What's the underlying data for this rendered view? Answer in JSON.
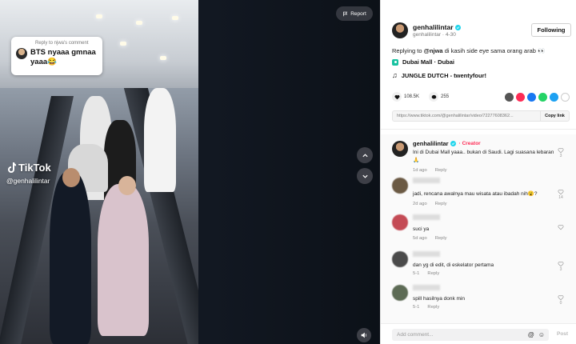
{
  "video": {
    "reply_to": "Reply to njwa's comment",
    "reply_text": "BTS nyaaa gmnaa yaaa😂",
    "watermark": "TikTok",
    "handle": "@genhalilintar",
    "report_label": "Report"
  },
  "post": {
    "username": "genhalilintar",
    "sub": "genhalilintar · 4-30",
    "follow_label": "Following",
    "description_prefix": "Replying to",
    "mention": "@njwa",
    "description_rest": " di kasih side eye sama orang arab 👀",
    "location": "Dubai Mall · Dubai",
    "music": "JUNGLE DUTCH - twentyfour!",
    "likes": "108.5K",
    "comments": "255",
    "link": "https://www.tiktok.com/@genhalilintar/video/72277608362...",
    "copy_label": "Copy link",
    "share_colors": [
      "#555555",
      "#fe2c55",
      "#1877f2",
      "#25d366",
      "#1da1f2",
      "#333333"
    ]
  },
  "comments": [
    {
      "name": "genhalilintar",
      "badge": "Creator",
      "text": "Ini di Dubai Mall yaaa.. bukan di Saudi. Lagi suasana lebaran 🙏",
      "time": "1d ago",
      "reply": "Reply",
      "likes": "3",
      "avatar_color": "#3a2f2a"
    },
    {
      "name": "",
      "badge": "",
      "text": "jadi, rencana awalnya mau wisata atau ibadah nih😮?",
      "time": "2d ago",
      "reply": "Reply",
      "likes": "14",
      "avatar_color": "#6b5a44"
    },
    {
      "name": "",
      "badge": "",
      "text": "suci ya",
      "time": "5d ago",
      "reply": "Reply",
      "likes": "",
      "avatar_color": "#c44b55"
    },
    {
      "name": "",
      "badge": "",
      "text": "dan yg di edit, di eskelator pertama",
      "time": "5-1",
      "reply": "Reply",
      "likes": "3",
      "avatar_color": "#4a4a4a"
    },
    {
      "name": "",
      "badge": "",
      "text": "spill hasilnya donk min",
      "time": "5-1",
      "reply": "Reply",
      "likes": "0",
      "avatar_color": "#5d6b55"
    }
  ],
  "input": {
    "placeholder": "Add comment...",
    "post_label": "Post"
  }
}
